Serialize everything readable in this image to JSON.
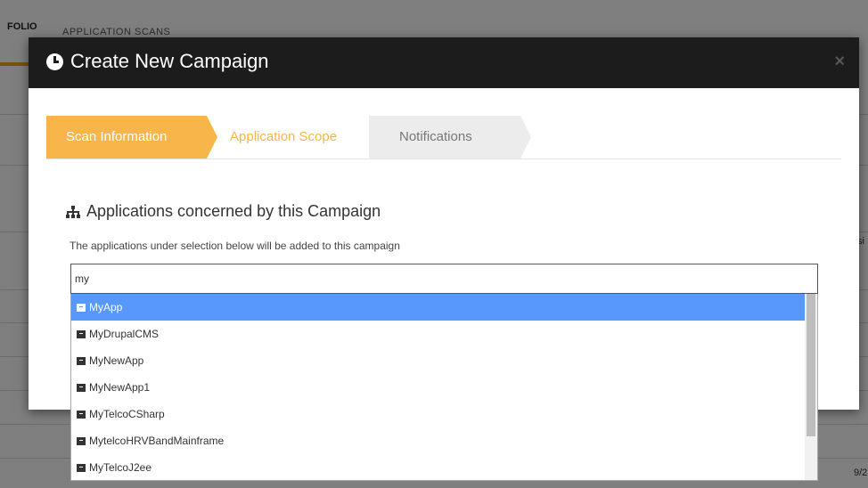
{
  "background": {
    "tab_active": "FOLIO",
    "tab_2": "APPLICATION SCANS",
    "edge_text_right": "si",
    "edge_text_bottom": "9/2",
    "orange_button_label": "▸"
  },
  "modal": {
    "title": "Create New Campaign",
    "close_label": "×",
    "steps": [
      {
        "label": "Scan Information",
        "state": "active"
      },
      {
        "label": "Application Scope",
        "state": "next"
      },
      {
        "label": "Notifications",
        "state": "pending"
      }
    ],
    "section_title": "Applications concerned by this Campaign",
    "section_desc": "The applications under selection below will be added to this campaign",
    "search_value": "my",
    "options": [
      {
        "label": "MyApp",
        "selected": true
      },
      {
        "label": "MyDrupalCMS"
      },
      {
        "label": "MyNewApp"
      },
      {
        "label": "MyNewApp1"
      },
      {
        "label": "MyTelcoCSharp"
      },
      {
        "label": "MytelcoHRVBandMainframe"
      },
      {
        "label": "MyTelcoJ2ee"
      }
    ]
  },
  "colors": {
    "accent": "#f7b54a",
    "selection": "#5897fb",
    "header": "#1c1c1c"
  }
}
